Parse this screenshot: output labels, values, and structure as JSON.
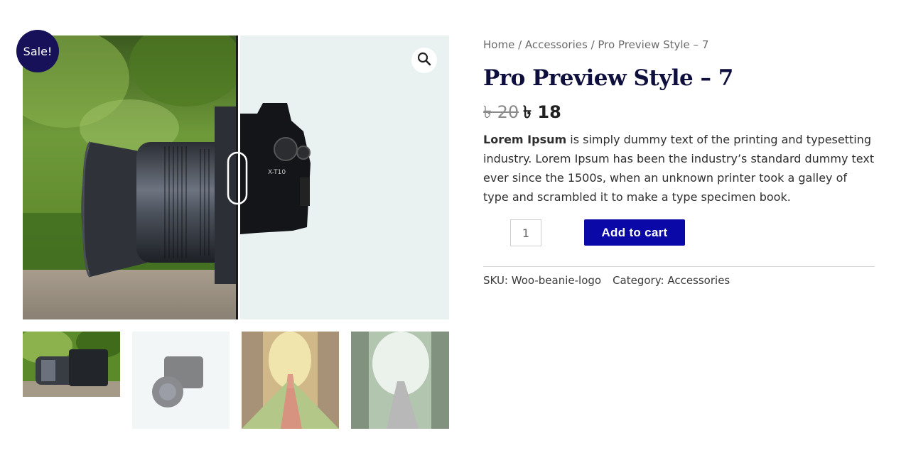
{
  "gallery": {
    "sale_badge": "Sale!",
    "zoom_icon": "magnifier-icon",
    "main_image": "camera-lens-outdoor-comparison",
    "thumbnails": [
      {
        "name": "camera-on-rock-thumb"
      },
      {
        "name": "camera-white-background-thumb"
      },
      {
        "name": "forest-path-autumn-thumb"
      },
      {
        "name": "misty-forest-road-thumb"
      }
    ]
  },
  "breadcrumb": {
    "home": "Home",
    "sep1": " / ",
    "category": "Accessories",
    "sep2": " / ",
    "current": "Pro Preview Style – 7"
  },
  "product": {
    "title": "Pro Preview Style – 7",
    "old_price": "৳ 20",
    "new_price": "৳ 18",
    "description_bold": "Lorem Ipsum",
    "description_rest": " is simply dummy text of the printing and typesetting industry. Lorem Ipsum has been the industry’s standard dummy text ever since the 1500s, when an unknown printer took a galley of type and scrambled it to make a type specimen book.",
    "quantity": "1",
    "add_to_cart": "Add to cart"
  },
  "meta": {
    "sku_label": "SKU: ",
    "sku_value": "Woo-beanie-logo",
    "category_label": "Category: ",
    "category_value": "Accessories"
  },
  "colors": {
    "title": "#0e0f3d",
    "button": "#0a08a6",
    "badge": "#17115a"
  }
}
